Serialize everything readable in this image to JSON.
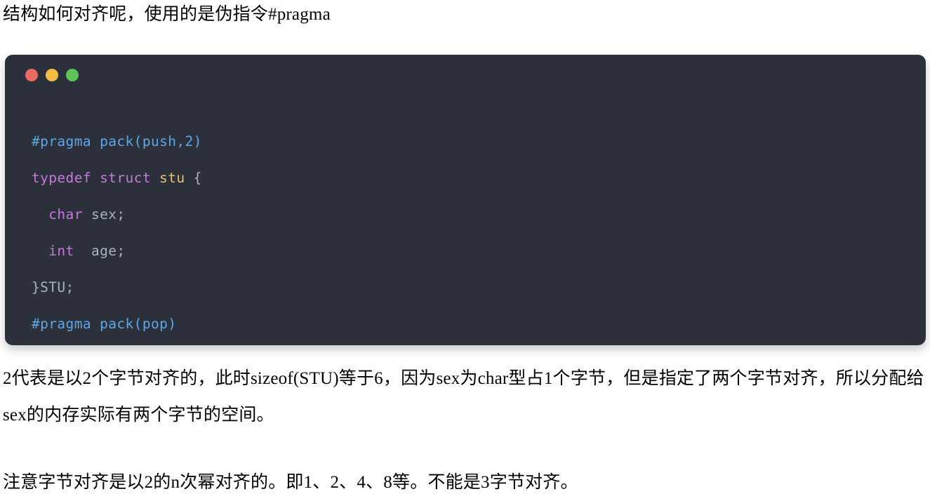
{
  "intro": {
    "text": "结构如何对齐呢，使用的是伪指令#pragma"
  },
  "code_card": {
    "window_dots": [
      {
        "name": "close-dot",
        "color": "#e96a5f"
      },
      {
        "name": "minimize-dot",
        "color": "#f2bd44"
      },
      {
        "name": "maximize-dot",
        "color": "#5ec45a"
      }
    ],
    "language": "c",
    "background": "#2b303b",
    "lines": [
      {
        "tokens": [
          {
            "text": "#pragma pack(push,2)",
            "class": "tok-pre"
          }
        ]
      },
      {
        "tokens": [
          {
            "text": "typedef struct ",
            "class": "tok-kw"
          },
          {
            "text": "stu ",
            "class": "tok-type"
          },
          {
            "text": "{",
            "class": "tok-punct"
          }
        ]
      },
      {
        "tokens": [
          {
            "text": "  ",
            "class": "tok-plain"
          },
          {
            "text": "char",
            "class": "tok-kw"
          },
          {
            "text": " sex;",
            "class": "tok-plain"
          }
        ]
      },
      {
        "tokens": [
          {
            "text": "  ",
            "class": "tok-plain"
          },
          {
            "text": "int",
            "class": "tok-kw"
          },
          {
            "text": "  age;",
            "class": "tok-plain"
          }
        ]
      },
      {
        "tokens": [
          {
            "text": "}STU;",
            "class": "tok-punct"
          }
        ]
      },
      {
        "tokens": [
          {
            "text": "#pragma pack(pop)",
            "class": "tok-pre"
          }
        ]
      }
    ],
    "plain_text": "#pragma pack(push,2)\ntypedef struct stu {\n  char sex;\n  int  age;\n}STU;\n#pragma pack(pop)"
  },
  "paragraphs": {
    "first": "2代表是以2个字节对齐的，此时sizeof(STU)等于6，因为sex为char型占1个字节，但是指定了两个字节对齐，所以分配给sex的内存实际有两个字节的空间。",
    "second": "注意字节对齐是以2的n次幂对齐的。即1、2、4、8等。不能是3字节对齐。"
  }
}
